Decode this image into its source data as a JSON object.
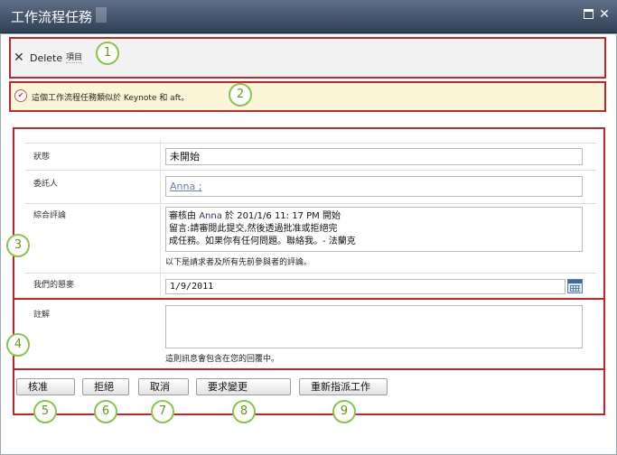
{
  "window": {
    "title": "工作流程任務",
    "maximize_icon": "maximize-icon",
    "close_icon": "close-icon"
  },
  "ribbon": {
    "delete_label": "Delete",
    "item_label": "項目"
  },
  "info": {
    "icon": "workflow-task-icon",
    "text": "這個工作流程任務類似於 Keynote 和 aft。"
  },
  "form": {
    "status": {
      "label": "狀態",
      "value": "未開始"
    },
    "assigned_to": {
      "label": "委託人",
      "value": "Anna ;"
    },
    "consolidated_comments": {
      "label": "綜合評論",
      "line1_prefix": "審核由",
      "line1_user": "Anna",
      "line1_suffix": "於 201/1/6 11: 17 PM 開始",
      "line2": "留言:請審閱此提交,然後透過批准或拒絕完",
      "line3": "成任務。如果你有任何問題。聯絡我。- 法蘭克",
      "note": "以下是請求者及所有先前參與者的評論。"
    },
    "due_date": {
      "label": "我們的懇麥",
      "value": "1/9/2011"
    },
    "comments": {
      "label": "註解",
      "value": "",
      "note": "這則訊息會包含在您的回覆中。"
    }
  },
  "buttons": {
    "approve": "核准",
    "reject": "拒絕",
    "cancel": "取消",
    "request_change": "要求變更",
    "reassign": "重新指派工作"
  },
  "callouts": [
    "1",
    "2",
    "3",
    "4",
    "5",
    "6",
    "7",
    "8",
    "9"
  ],
  "colors": {
    "annotation_red": "#c0272d",
    "callout_green": "#8ac44a",
    "titlebar": "#3e4f66",
    "infobar": "#fcf6d9"
  }
}
